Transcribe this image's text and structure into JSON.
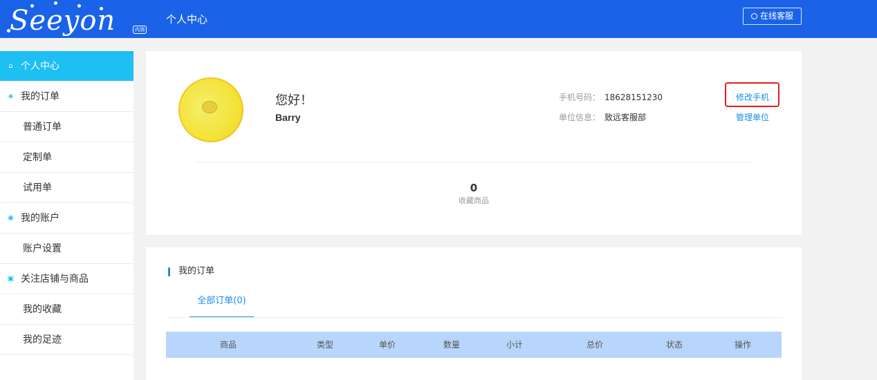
{
  "header": {
    "logo_text": "Seeyon",
    "logo_badge": "内测",
    "title": "个人中心",
    "service_button": "在线客服"
  },
  "sidebar": {
    "items": [
      {
        "label": "个人中心",
        "kind": "group",
        "icon": "home-icon",
        "active": true
      },
      {
        "label": "我的订单",
        "kind": "group",
        "icon": "layers-icon"
      },
      {
        "label": "普通订单",
        "kind": "sub"
      },
      {
        "label": "定制单",
        "kind": "sub"
      },
      {
        "label": "试用单",
        "kind": "sub"
      },
      {
        "label": "我的账户",
        "kind": "group",
        "icon": "account-icon"
      },
      {
        "label": "账户设置",
        "kind": "sub"
      },
      {
        "label": "关注店铺与商品",
        "kind": "group",
        "icon": "heart-icon"
      },
      {
        "label": "我的收藏",
        "kind": "sub"
      },
      {
        "label": "我的足迹",
        "kind": "sub"
      }
    ]
  },
  "profile": {
    "greeting": "您好！",
    "username": "Barry",
    "phone_label": "手机号码：",
    "phone_value": "18628151230",
    "unit_label": "单位信息：",
    "unit_value": "致远客服部",
    "change_phone": "修改手机",
    "manage_unit": "管理单位",
    "favorites_count": "0",
    "favorites_label": "收藏商品"
  },
  "orders": {
    "section_title": "我的订单",
    "tab_all": "全部订单(0)",
    "columns": [
      "商品",
      "类型",
      "单价",
      "数量",
      "小计",
      "总价",
      "状态",
      "操作"
    ]
  },
  "colors": {
    "header_bg": "#1a63e8",
    "accent": "#1ec0f3",
    "link": "#1a8fe8",
    "highlight": "#e31b1b",
    "table_header": "#b8d6fb"
  }
}
